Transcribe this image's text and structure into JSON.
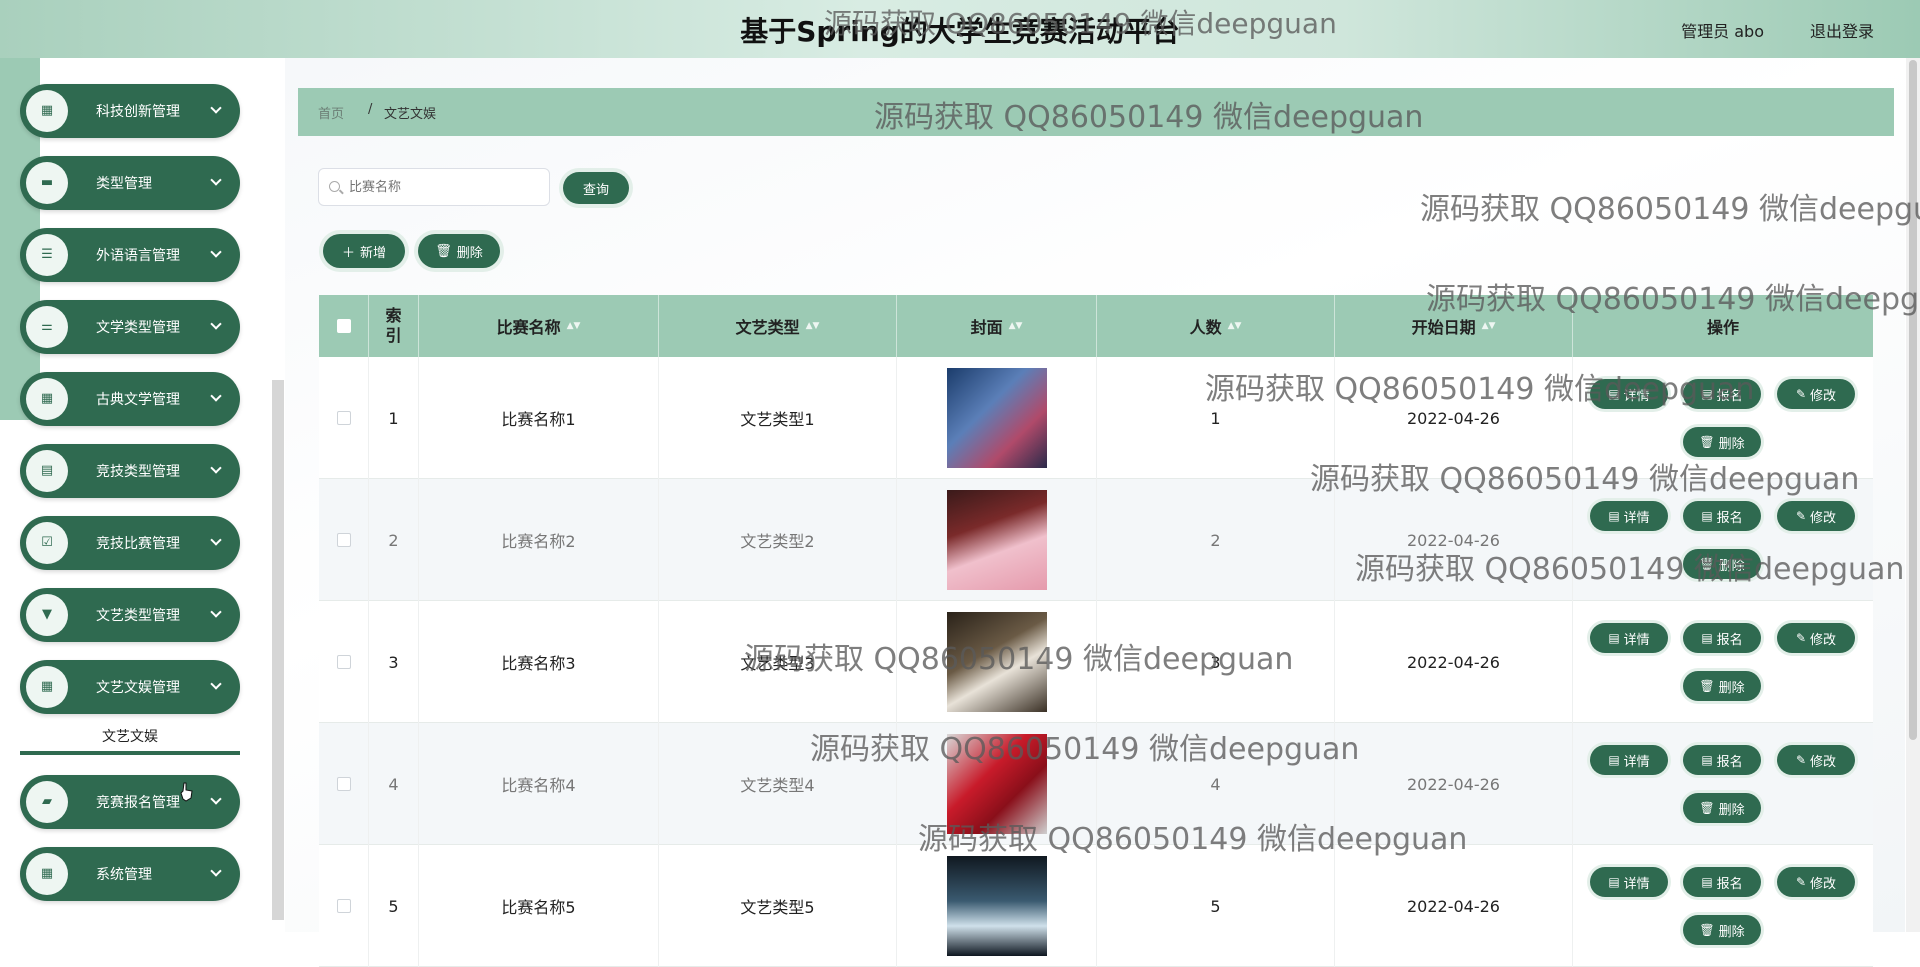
{
  "header": {
    "title": "基于Spring的大学生竞赛活动平台",
    "user": "管理员 abo",
    "logout": "退出登录"
  },
  "sidebar": {
    "items": [
      {
        "label": "科技创新管理",
        "icon": "grid-icon"
      },
      {
        "label": "类型管理",
        "icon": "book-icon"
      },
      {
        "label": "外语语言管理",
        "icon": "list-icon"
      },
      {
        "label": "文学类型管理",
        "icon": "sliders-icon"
      },
      {
        "label": "古典文学管理",
        "icon": "grid-icon"
      },
      {
        "label": "竞技类型管理",
        "icon": "clipboard-icon"
      },
      {
        "label": "竞技比赛管理",
        "icon": "clipboard-check-icon"
      },
      {
        "label": "文艺类型管理",
        "icon": "pin-icon"
      },
      {
        "label": "文艺文娱管理",
        "icon": "grid-icon"
      },
      {
        "label": "竞赛报名管理",
        "icon": "ticket-icon"
      },
      {
        "label": "系统管理",
        "icon": "grid-icon"
      }
    ],
    "submenu_label": "文艺文娱"
  },
  "breadcrumb": {
    "home": "首页",
    "separator": "/",
    "current": "文艺文娱"
  },
  "search": {
    "placeholder": "比赛名称",
    "button": "查询"
  },
  "toolbar": {
    "add": "新增",
    "delete": "删除"
  },
  "table": {
    "headers": [
      "索引",
      "比赛名称",
      "文艺类型",
      "封面",
      "人数",
      "开始日期",
      "操作"
    ],
    "rows": [
      {
        "index": "1",
        "name": "比赛名称1",
        "type": "文艺类型1",
        "count": "1",
        "date": "2022-04-26"
      },
      {
        "index": "2",
        "name": "比赛名称2",
        "type": "文艺类型2",
        "count": "2",
        "date": "2022-04-26"
      },
      {
        "index": "3",
        "name": "比赛名称3",
        "type": "文艺类型3",
        "count": "3",
        "date": "2022-04-26"
      },
      {
        "index": "4",
        "name": "比赛名称4",
        "type": "文艺类型4",
        "count": "4",
        "date": "2022-04-26"
      },
      {
        "index": "5",
        "name": "比赛名称5",
        "type": "文艺类型5",
        "count": "5",
        "date": "2022-04-26"
      }
    ],
    "actions": {
      "detail": "详情",
      "signup": "报名",
      "edit": "修改",
      "delete": "删除"
    }
  },
  "watermark": "源码获取 QQ86050149 微信deepguan",
  "colors": {
    "primary": "#2f6a50",
    "header_light": "#9ccab4"
  }
}
